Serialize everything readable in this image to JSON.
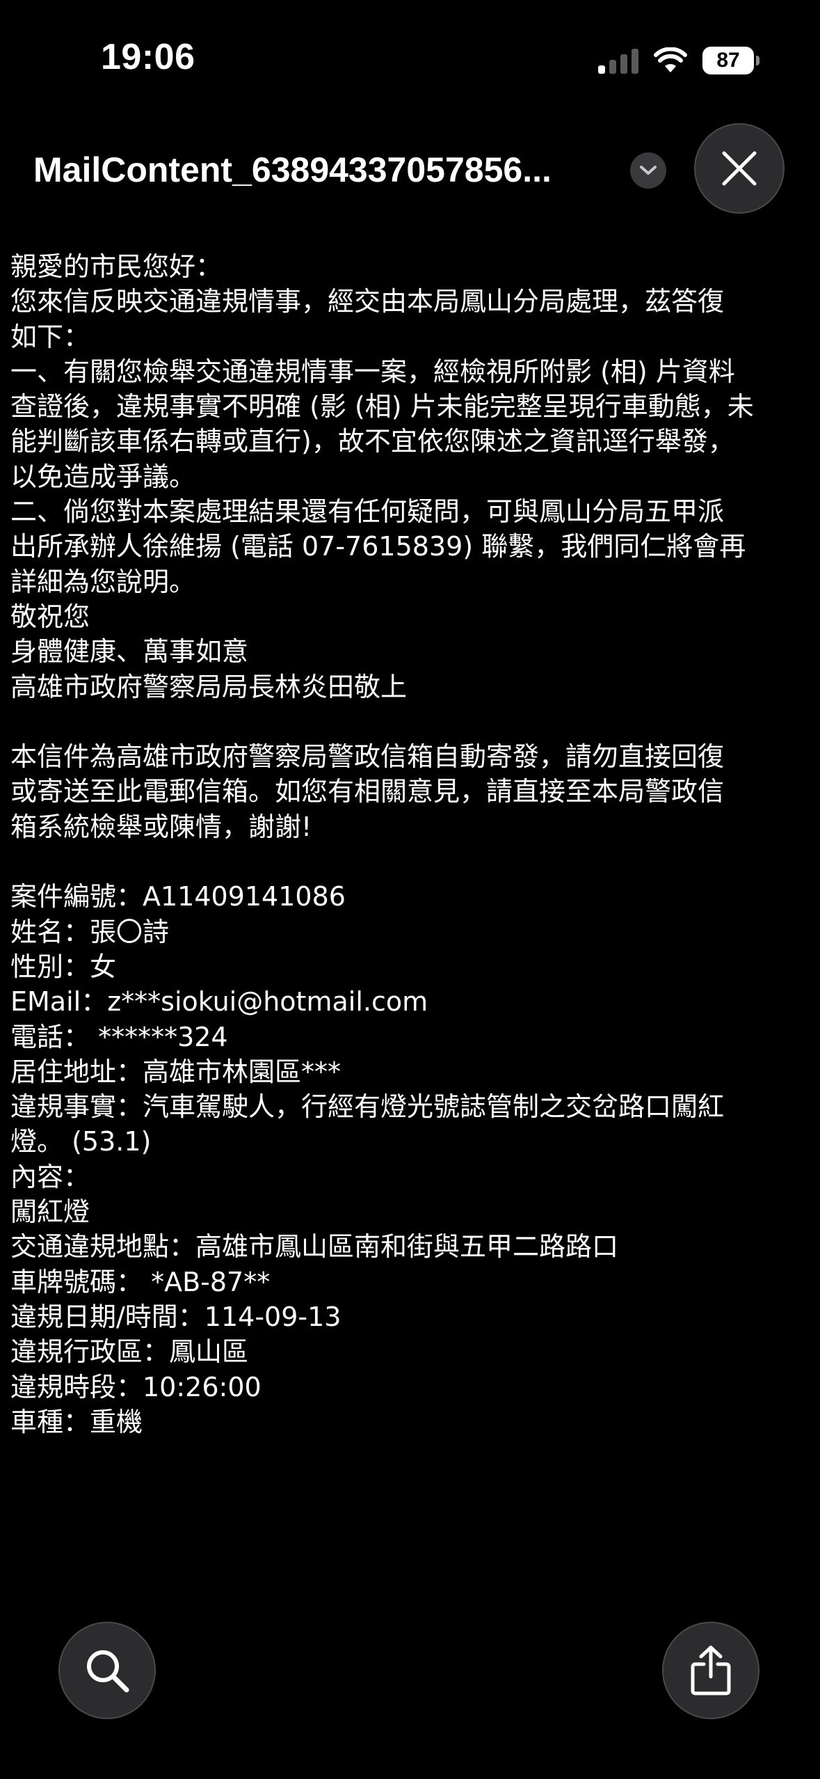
{
  "status_bar": {
    "time": "19:06",
    "battery": "87"
  },
  "title_bar": {
    "title": "MailContent_63894337057856..."
  },
  "mail_body": [
    "親愛的市民您好：",
    "您來信反映交通違規情事，經交由本局鳳山分局處理，茲答復",
    "如下：",
    "一、有關您檢舉交通違規情事一案，經檢視所附影 (相) 片資料",
    "查證後，違規事實不明確 (影 (相) 片未能完整呈現行車動態，未",
    "能判斷該車係右轉或直行)，故不宜依您陳述之資訊逕行舉發，",
    "以免造成爭議。",
    "二、倘您對本案處理結果還有任何疑問，可與鳳山分局五甲派",
    "出所承辦人徐維揚 (電話 07-7615839) 聯繫，我們同仁將會再",
    "詳細為您說明。",
    "敬祝您",
    "身體健康、萬事如意",
    "高雄市政府警察局局長林炎田敬上",
    "",
    "本信件為高雄市政府警察局警政信箱自動寄發，請勿直接回復",
    "或寄送至此電郵信箱。如您有相關意見，請直接至本局警政信",
    "箱系統檢舉或陳情，謝謝!",
    "",
    "案件編號：A11409141086",
    "姓名：張〇詩",
    "性別：女",
    "EMail：z***siokui@hotmail.com",
    "電話： ******324",
    "居住地址：高雄市林園區***",
    "違規事實：汽車駕駛人，行經有燈光號誌管制之交岔路口闖紅",
    "燈。 (53.1)",
    "內容：",
    "闖紅燈",
    "交通違規地點：高雄市鳳山區南和街與五甲二路路口",
    "車牌號碼： *AB-87**",
    "違規日期/時間：114-09-13",
    "違規行政區：鳳山區",
    "違規時段：10:26:00",
    "車種：重機"
  ],
  "icons": {
    "signal": "cellular-signal-icon",
    "wifi": "wifi-icon",
    "chevron": "chevron-down-icon",
    "close": "close-icon",
    "search": "search-icon",
    "share": "share-icon"
  },
  "colors": {
    "background": "#000000",
    "text": "#ffffff",
    "button_bg": "#2c2c2e"
  }
}
